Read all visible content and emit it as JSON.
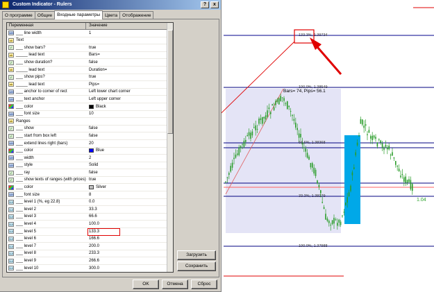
{
  "window": {
    "title": "Custom Indicator - Rulers",
    "help_label": "?",
    "close_label": "x"
  },
  "tabs": [
    {
      "label": "О программе",
      "active": false
    },
    {
      "label": "Общие",
      "active": false
    },
    {
      "label": "Входные параметры",
      "active": true
    },
    {
      "label": "Цвета",
      "active": false
    },
    {
      "label": "Отображение",
      "active": false
    }
  ],
  "grid": {
    "columns": [
      "Переменная",
      "Значение"
    ],
    "rows": [
      {
        "icon": "int",
        "name": "___ line width",
        "value": "1"
      },
      {
        "icon": "text",
        "name": "Text",
        "value": ""
      },
      {
        "icon": "bool",
        "name": "___ show bars?",
        "value": "true"
      },
      {
        "icon": "text",
        "name": "_____ lead text",
        "value": "Bars="
      },
      {
        "icon": "bool",
        "name": "___ show duration?",
        "value": "false"
      },
      {
        "icon": "text",
        "name": "_____ lead text",
        "value": "Duration="
      },
      {
        "icon": "bool",
        "name": "___ show pips?",
        "value": "true"
      },
      {
        "icon": "text",
        "name": "_____ lead text",
        "value": "Pips="
      },
      {
        "icon": "int",
        "name": "___ anchor to corner of rect",
        "value": "Left lower chart corner"
      },
      {
        "icon": "int",
        "name": "___ text anchor",
        "value": "Left upper corner"
      },
      {
        "icon": "color",
        "name": "___ color",
        "value": "Black",
        "swatch": "#000000"
      },
      {
        "icon": "int",
        "name": "___ font size",
        "value": "10"
      },
      {
        "icon": "text",
        "name": "Ranges",
        "value": ""
      },
      {
        "icon": "bool",
        "name": "___ show",
        "value": "false"
      },
      {
        "icon": "bool",
        "name": "___ start from box left",
        "value": "false"
      },
      {
        "icon": "int",
        "name": "___ extend lines right (bars)",
        "value": "20"
      },
      {
        "icon": "color",
        "name": "___ color",
        "value": "Blue",
        "swatch": "#0000ff"
      },
      {
        "icon": "int",
        "name": "___ width",
        "value": "2"
      },
      {
        "icon": "int",
        "name": "___ style",
        "value": "Solid"
      },
      {
        "icon": "bool",
        "name": "___ ray",
        "value": "false"
      },
      {
        "icon": "bool",
        "name": "___ show texts of ranges (with prices)",
        "value": "true"
      },
      {
        "icon": "color",
        "name": "___ color",
        "value": "Silver",
        "swatch": "#c0c0c0"
      },
      {
        "icon": "int",
        "name": "___ font size",
        "value": "8"
      },
      {
        "icon": "dbl",
        "name": "___ level 1 (%, eg 22.8)",
        "value": "0.0"
      },
      {
        "icon": "dbl",
        "name": "___ level 2",
        "value": "33.3"
      },
      {
        "icon": "dbl",
        "name": "___ level 3",
        "value": "66.6"
      },
      {
        "icon": "dbl",
        "name": "___ level 4",
        "value": "100.0"
      },
      {
        "icon": "dbl",
        "name": "___ level 5",
        "value": "133.3",
        "highlighted": true
      },
      {
        "icon": "dbl",
        "name": "___ level 6",
        "value": "166.6"
      },
      {
        "icon": "dbl",
        "name": "___ level 7",
        "value": "200.0"
      },
      {
        "icon": "dbl",
        "name": "___ level 8",
        "value": "233.3"
      },
      {
        "icon": "dbl",
        "name": "___ level 9",
        "value": "266.6"
      },
      {
        "icon": "dbl",
        "name": "___ level 10",
        "value": "300.0"
      }
    ]
  },
  "buttons": {
    "load": "Загрузить",
    "save": "Сохранить",
    "ok": "OK",
    "cancel": "Отмена",
    "reset": "Сброс"
  },
  "chart": {
    "labels": {
      "top_level": "133.3%, 1.39734",
      "bars_pips": "Bars= 74, Pips= 56.1",
      "level_100": "100.0%, 1.38549",
      "level_66": "66.6%, 1.38368",
      "level_33": "33.3%, 1.38179",
      "level_0": "100.0%, 1.37988"
    },
    "current_price": "1.04",
    "colors": {
      "box_fill": "#e4e4f6",
      "blue_box": "#00a8e8",
      "arrow": "#e00000",
      "candle_up": "#2a9d2a",
      "candle_down": "#2a9d2a"
    }
  }
}
